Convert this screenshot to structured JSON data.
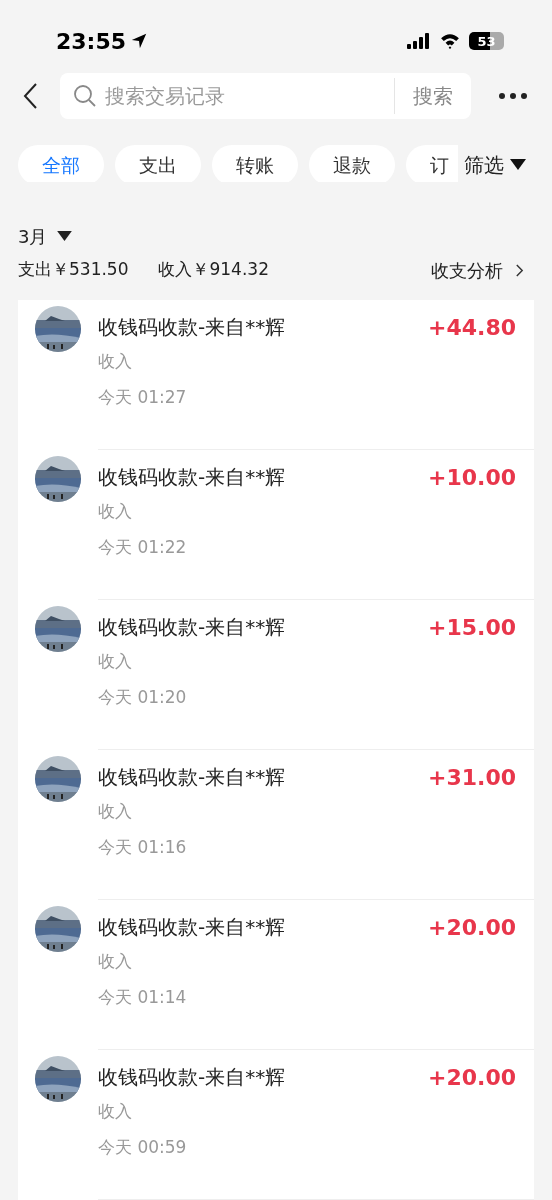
{
  "status_bar": {
    "time": "23:55",
    "battery": "53"
  },
  "search": {
    "placeholder": "搜索交易记录",
    "button": "搜索"
  },
  "tabs": [
    {
      "label": "全部",
      "selected": true
    },
    {
      "label": "支出",
      "selected": false
    },
    {
      "label": "转账",
      "selected": false
    },
    {
      "label": "退款",
      "selected": false
    },
    {
      "label": "订",
      "selected": false
    }
  ],
  "filter": "筛选",
  "month": "3月",
  "summary": {
    "expense": "支出￥531.50",
    "income": "收入￥914.32",
    "analysis": "收支分析"
  },
  "transactions": [
    {
      "title": "收钱码收款-来自**辉",
      "category": "收入",
      "time": "今天 01:27",
      "amount": "+44.80"
    },
    {
      "title": "收钱码收款-来自**辉",
      "category": "收入",
      "time": "今天 01:22",
      "amount": "+10.00"
    },
    {
      "title": "收钱码收款-来自**辉",
      "category": "收入",
      "time": "今天 01:20",
      "amount": "+15.00"
    },
    {
      "title": "收钱码收款-来自**辉",
      "category": "收入",
      "time": "今天 01:16",
      "amount": "+31.00"
    },
    {
      "title": "收钱码收款-来自**辉",
      "category": "收入",
      "time": "今天 01:14",
      "amount": "+20.00"
    },
    {
      "title": "收钱码收款-来自**辉",
      "category": "收入",
      "time": "今天 00:59",
      "amount": "+20.00"
    }
  ]
}
